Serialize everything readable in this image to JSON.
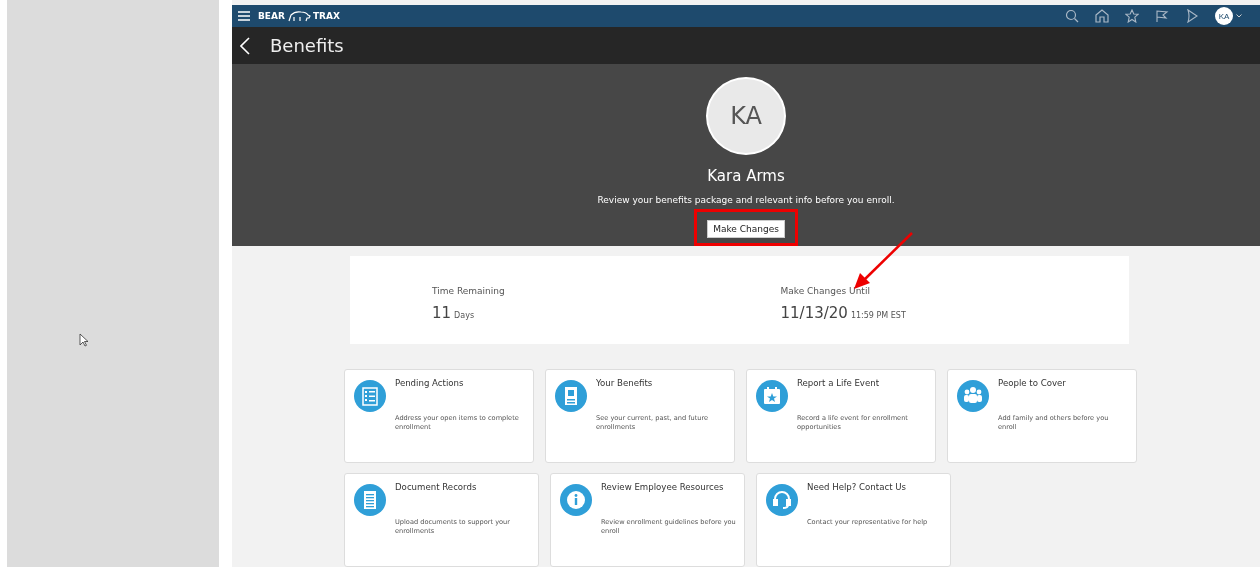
{
  "topbar": {
    "logo_left": "BEAR",
    "logo_right": "TRAX",
    "avatar": "KA"
  },
  "header": {
    "title": "Benefits"
  },
  "profile": {
    "initials": "KA",
    "name": "Kara Arms",
    "message": "Review your benefits package and relevant info before you enroll.",
    "button": "Make Changes"
  },
  "summary": [
    {
      "label": "Time Remaining",
      "value": "11",
      "unit": "Days"
    },
    {
      "label": "Make Changes Until",
      "value": "11/13/20",
      "unit": "11:59 PM  EST"
    }
  ],
  "tiles": [
    {
      "title": "Pending Actions",
      "description": "Address your open items to complete enrollment"
    },
    {
      "title": "Your Benefits",
      "description": "See your current, past, and future enrollments"
    },
    {
      "title": "Report a Life Event",
      "description": "Record a life event for enrollment opportunities"
    },
    {
      "title": "People to Cover",
      "description": "Add family and others before you enroll"
    },
    {
      "title": "Document Records",
      "description": "Upload documents to support your enrollments"
    },
    {
      "title": "Review Employee Resources",
      "description": "Review enrollment guidelines before you enroll"
    },
    {
      "title": "Need Help? Contact Us",
      "description": "Contact your representative for help"
    }
  ]
}
